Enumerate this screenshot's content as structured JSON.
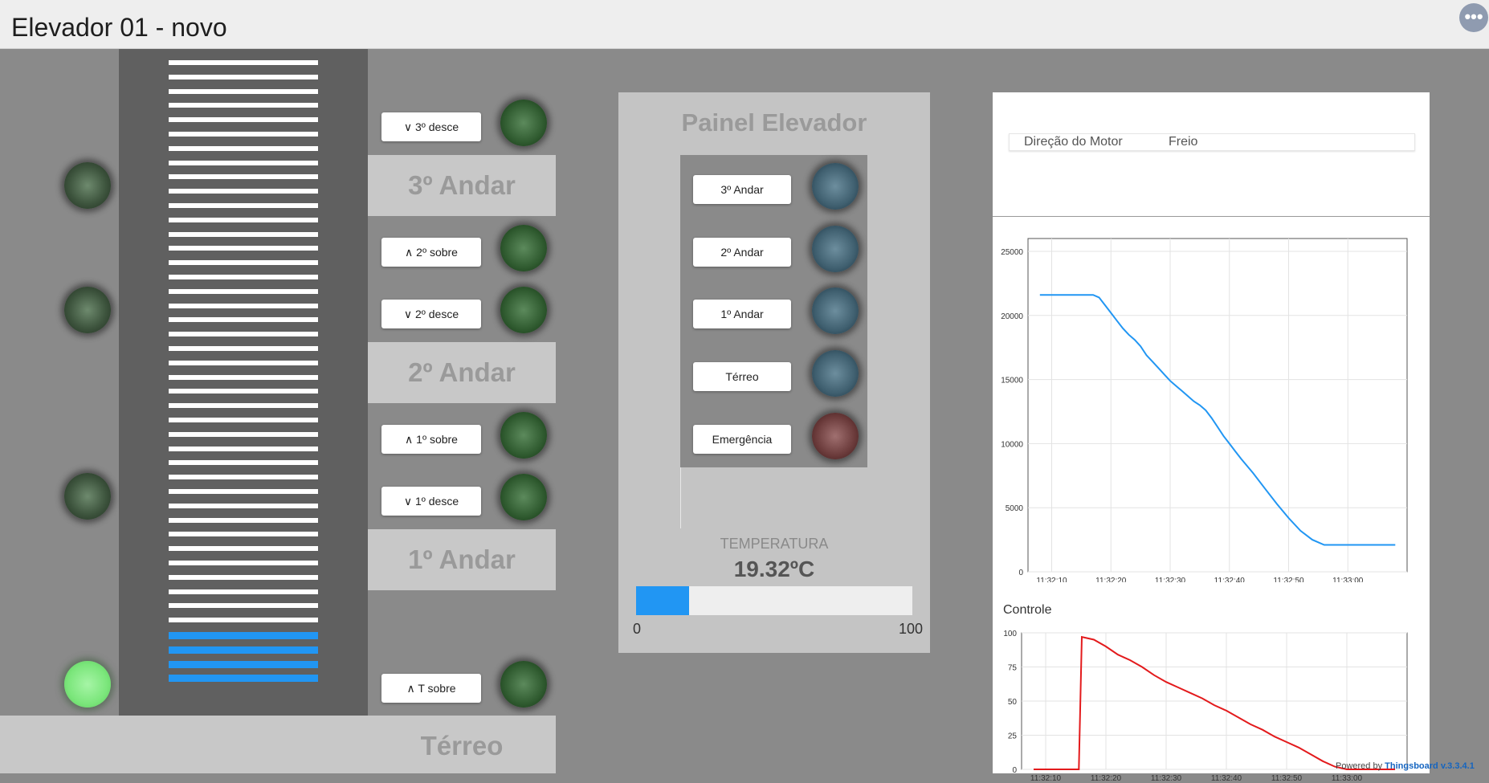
{
  "header": {
    "title": "Elevador 01 - novo",
    "more_icon": "more-horiz-icon",
    "more_glyph": "•••"
  },
  "shaft": {
    "total_segments": 44,
    "filled_segments": 4,
    "bar_color": "#ffffff",
    "filled_color": "#2196f3"
  },
  "lights": [
    {
      "name": "3",
      "on": false
    },
    {
      "name": "2",
      "on": false
    },
    {
      "name": "1",
      "on": false
    },
    {
      "name": "T",
      "on": true
    }
  ],
  "floors": {
    "f3": "3º Andar",
    "f2": "2º Andar",
    "f1": "1º Andar",
    "t": "Térreo"
  },
  "calls": {
    "c3_down": "∨ 3º desce",
    "c2_up": "∧ 2º sobre",
    "c2_down": "∨ 2º desce",
    "c1_up": "∧ 1º sobre",
    "c1_down": "∨ 1º desce",
    "t_up": "∧ T sobre"
  },
  "panel": {
    "title": "Painel Elevador",
    "buttons": {
      "andar3": "3º Andar",
      "andar2": "2º Andar",
      "andar1": "1º Andar",
      "terreo": "Térreo",
      "emergencia": "Emergência"
    },
    "temperature": {
      "label": "TEMPERATURA",
      "value_text": "19.32ºC",
      "value": 19.32,
      "min": "0",
      "max": "100",
      "bar_color": "#2196f3"
    }
  },
  "status_legend": {
    "motor": "Direção do Motor",
    "brake": "Freio"
  },
  "chart_data": [
    {
      "type": "line",
      "title": "",
      "x_ticks": [
        "11:32:10",
        "11:32:20",
        "11:32:30",
        "11:32:40",
        "11:32:50",
        "11:33:00"
      ],
      "y_ticks": [
        "0",
        "5000",
        "10000",
        "15000",
        "20000",
        "25000"
      ],
      "ylim": [
        0,
        26000
      ],
      "color": "#2196f3",
      "series": [
        {
          "x": [
            6,
            8,
            10,
            12,
            14,
            15,
            16,
            17,
            18,
            19,
            20,
            21,
            22,
            23,
            24,
            25,
            26,
            27,
            28,
            29,
            30,
            31,
            32,
            33,
            34,
            35,
            36,
            37,
            38,
            39,
            40,
            42,
            44,
            46,
            48,
            50,
            52,
            54,
            56,
            58,
            59,
            60,
            62,
            64,
            66
          ],
          "y": [
            21600,
            21600,
            21600,
            21600,
            21600,
            21600,
            21400,
            20800,
            20200,
            19600,
            19000,
            18500,
            18100,
            17600,
            16900,
            16400,
            15900,
            15400,
            14900,
            14500,
            14100,
            13700,
            13300,
            13000,
            12600,
            12000,
            11300,
            10600,
            10000,
            9400,
            8800,
            7700,
            6500,
            5300,
            4200,
            3200,
            2500,
            2100,
            2100,
            2100,
            2100,
            2100,
            2100,
            2100,
            2100
          ]
        }
      ]
    },
    {
      "type": "line",
      "title": "Controle",
      "x_ticks": [
        "11:32:10",
        "11:32:20",
        "11:32:30",
        "11:32:40",
        "11:32:50",
        "11:33:00"
      ],
      "y_ticks": [
        "0",
        "25",
        "50",
        "75",
        "100"
      ],
      "ylim": [
        0,
        100
      ],
      "color": "#e31a1c",
      "series": [
        {
          "x": [
            6,
            8,
            10,
            12,
            13.5,
            14,
            16,
            18,
            20,
            22,
            24,
            26,
            28,
            30,
            32,
            34,
            36,
            38,
            40,
            42,
            44,
            46,
            48,
            50,
            52,
            54,
            56,
            58,
            60,
            62,
            64,
            66
          ],
          "y": [
            0,
            0,
            0,
            0,
            0,
            97,
            95,
            90,
            84,
            80,
            75,
            69,
            64,
            60,
            56,
            52,
            47,
            43,
            38,
            33,
            29,
            24,
            20,
            16,
            11,
            6,
            2,
            0,
            0,
            0,
            0,
            0
          ]
        }
      ]
    }
  ],
  "charts": {
    "position": {
      "title": ""
    },
    "control": {
      "title": "Controle"
    }
  },
  "footer": {
    "powered": "Powered by",
    "brand": "Thingsboard v.3.3.4.1"
  }
}
